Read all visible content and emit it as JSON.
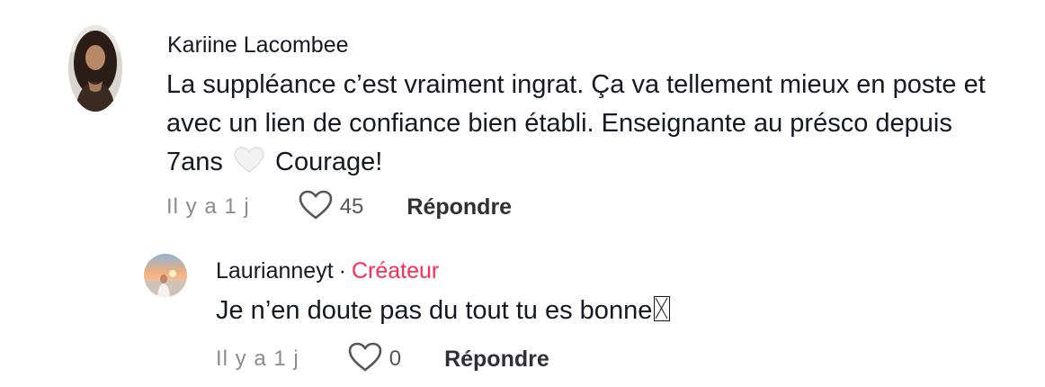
{
  "comments": [
    {
      "author": "Kariine Lacombee",
      "text_before_emoji": "La suppléance c’est vraiment ingrat. Ça va tellement mieux en poste et avec un lien de confiance bien établi. Enseignante au présco depuis 7ans",
      "emoji": "white-heart-icon",
      "text_after_emoji": "Courage!",
      "time": "Il y a 1 j",
      "likes": "45",
      "reply_label": "Répondre"
    }
  ],
  "reply": {
    "author": "Laurianneyt",
    "separator": "·",
    "badge": "Créateur",
    "text": "Je n’en doute pas du tout tu es bonne",
    "time": "Il y a 1 j",
    "likes": "0",
    "reply_label": "Répondre"
  },
  "colors": {
    "text": "#161823",
    "muted": "#8a8b91",
    "creator_badge": "#fe2c55"
  }
}
